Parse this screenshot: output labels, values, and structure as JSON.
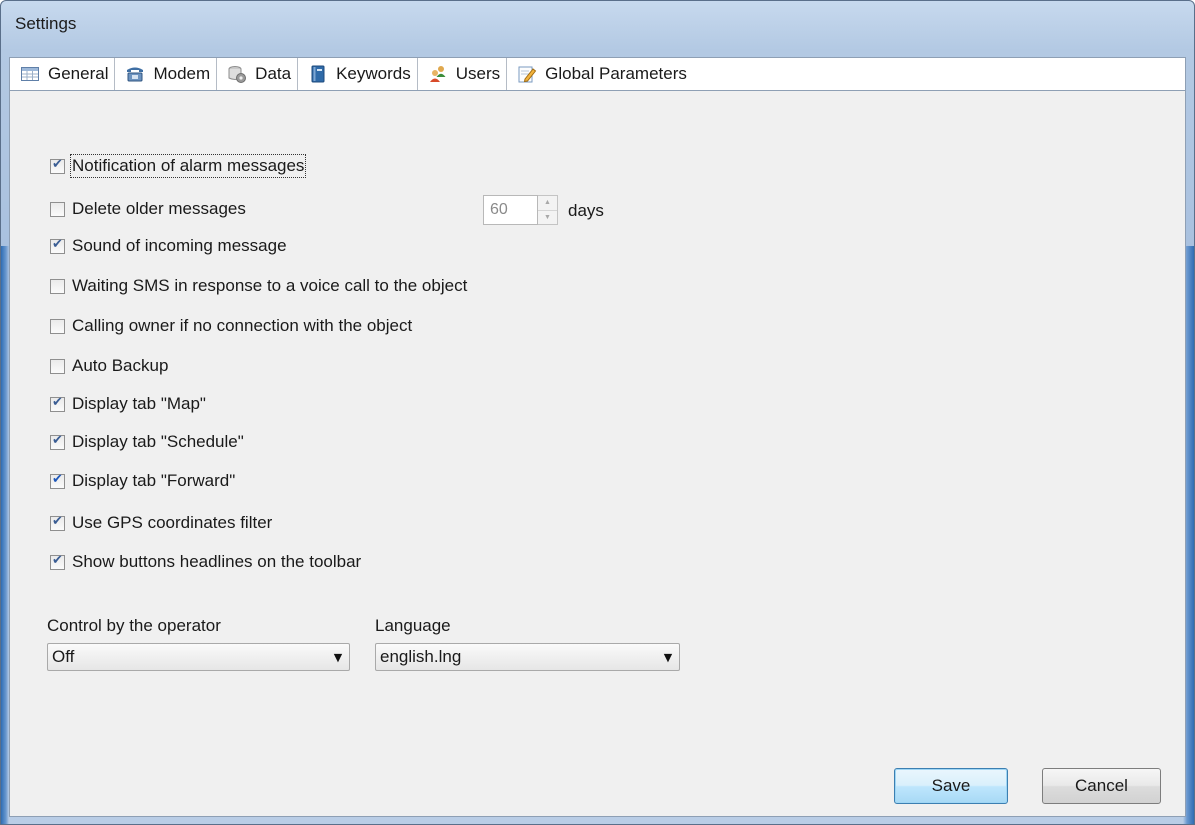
{
  "window": {
    "title": "Settings"
  },
  "tabs": [
    {
      "label": "General",
      "icon": "table-icon"
    },
    {
      "label": "Modem",
      "icon": "phone-icon"
    },
    {
      "label": "Data",
      "icon": "database-gear-icon"
    },
    {
      "label": "Keywords",
      "icon": "book-icon"
    },
    {
      "label": "Users",
      "icon": "users-icon"
    },
    {
      "label": "Global Parameters",
      "icon": "pencil-note-icon"
    }
  ],
  "general": {
    "options": [
      {
        "label": "Notification of alarm messages",
        "checked": true
      },
      {
        "label": "Delete older messages",
        "checked": false
      },
      {
        "label": "Sound of incoming message",
        "checked": true
      },
      {
        "label": "Waiting SMS in response to a voice call to the object",
        "checked": false
      },
      {
        "label": "Calling owner if no connection with the object",
        "checked": false
      },
      {
        "label": "Auto Backup",
        "checked": false
      },
      {
        "label": "Display tab \"Map\"",
        "checked": true
      },
      {
        "label": "Display tab \"Schedule\"",
        "checked": true
      },
      {
        "label": "Display tab \"Forward\"",
        "checked": true
      },
      {
        "label": "Use GPS coordinates filter",
        "checked": true
      },
      {
        "label": "Show buttons headlines on the toolbar",
        "checked": true
      }
    ],
    "delete_days": {
      "value": "60",
      "unit": "days"
    },
    "operator_control": {
      "label": "Control by the operator",
      "value": "Off"
    },
    "language": {
      "label": "Language",
      "value": "english.lng"
    }
  },
  "buttons": {
    "save": "Save",
    "cancel": "Cancel"
  }
}
